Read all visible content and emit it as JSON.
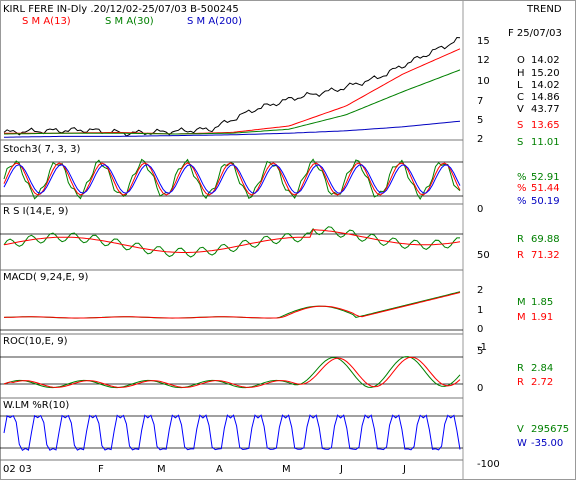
{
  "header": {
    "title": "KIRL FERE IN-Dly .20/12/02-25/07/03  B-500245",
    "trend": "TREND",
    "date": "F 25/07/03",
    "legend": [
      {
        "text": "S M A(13)",
        "color": "#ff0000"
      },
      {
        "text": "S M A(30)",
        "color": "#008000"
      },
      {
        "text": "S M A(200)",
        "color": "#0000c0"
      }
    ]
  },
  "colors": {
    "price": "#000000",
    "sma13": "#ff0000",
    "sma30": "#008000",
    "sma200": "#0000c0",
    "grid": "#000000",
    "blueline": "#0000ff",
    "redline": "#ff0000",
    "greenline": "#008000"
  },
  "x_labels": [
    "02",
    "03",
    "F",
    "M",
    "A",
    "M",
    "J",
    "J"
  ],
  "panels": [
    {
      "id": "price",
      "title": "",
      "ticks": [
        "15",
        "12",
        "10",
        "7",
        "5",
        "2"
      ],
      "readouts": [
        {
          "label": "O",
          "value": "14.02",
          "color": "#000000"
        },
        {
          "label": "H",
          "value": "15.20",
          "color": "#000000"
        },
        {
          "label": "L",
          "value": "14.02",
          "color": "#000000"
        },
        {
          "label": "C",
          "value": "14.86",
          "color": "#000000"
        },
        {
          "label": "V",
          "value": "43.77",
          "color": "#000000"
        },
        {
          "label": "S",
          "value": "13.65",
          "color": "#ff0000"
        },
        {
          "label": "S",
          "value": "11.01",
          "color": "#008000"
        }
      ]
    },
    {
      "id": "stoch",
      "title": "Stoch3( 7, 3, 3)",
      "ticks": [
        "0"
      ],
      "readouts": [
        {
          "label": "%",
          "value": "52.91",
          "color": "#008000"
        },
        {
          "label": "%",
          "value": "51.44",
          "color": "#ff0000"
        },
        {
          "label": "%",
          "value": "50.19",
          "color": "#0000c0"
        }
      ]
    },
    {
      "id": "rsi",
      "title": "R S I(14,E, 9)",
      "ticks": [
        "50"
      ],
      "readouts": [
        {
          "label": "R",
          "value": "69.88",
          "color": "#008000"
        },
        {
          "label": "R",
          "value": "71.32",
          "color": "#ff0000"
        }
      ]
    },
    {
      "id": "macd",
      "title": "MACD( 9,24,E, 9)",
      "ticks": [
        "2",
        "1",
        "0",
        "-1"
      ],
      "readouts": [
        {
          "label": "M",
          "value": "1.85",
          "color": "#008000"
        },
        {
          "label": "M",
          "value": "1.91",
          "color": "#ff0000"
        }
      ]
    },
    {
      "id": "roc",
      "title": "ROC(10,E, 9)",
      "ticks": [
        "5",
        "0"
      ],
      "readouts": [
        {
          "label": "R",
          "value": "2.84",
          "color": "#008000"
        },
        {
          "label": "R",
          "value": "2.72",
          "color": "#ff0000"
        }
      ]
    },
    {
      "id": "wlm",
      "title": "W.LM %R(10)",
      "ticks": [
        "-100"
      ],
      "readouts": [
        {
          "label": "V",
          "value": "295675",
          "color": "#008000"
        },
        {
          "label": "W",
          "value": "-35.00",
          "color": "#0000c0"
        }
      ]
    }
  ],
  "chart_data": {
    "type": "line",
    "title": "KIRL FERE IN-Dly .20/12/02-25/07/03  B-500245",
    "x": [
      "02",
      "03",
      "F",
      "M",
      "A",
      "M",
      "J",
      "J"
    ],
    "series": [
      {
        "name": "S M A(13)",
        "values": [
          3.1,
          3.1,
          3.2,
          3.0,
          3.2,
          4.0,
          6.5,
          10.5,
          13.65
        ]
      },
      {
        "name": "S M A(30)",
        "values": [
          3.0,
          3.1,
          3.1,
          3.0,
          3.1,
          3.6,
          5.4,
          8.3,
          11.01
        ]
      },
      {
        "name": "S M A(200)",
        "values": [
          2.6,
          2.7,
          2.7,
          2.8,
          2.9,
          3.1,
          3.4,
          3.9,
          4.6
        ]
      }
    ],
    "ylim": [
      2,
      17
    ],
    "price_close": [
      3.2,
      3.4,
      3.5,
      3.1,
      3.3,
      3.6,
      6.0,
      7.5,
      8.5,
      10.0,
      12.5,
      14.86
    ],
    "indicators": {
      "stoch": {
        "values": [
          52.91,
          51.44,
          50.19
        ],
        "ylim": [
          0,
          100
        ]
      },
      "rsi": {
        "values": [
          69.88,
          71.32
        ]
      },
      "macd": {
        "values": [
          1.85,
          1.91
        ],
        "ylim": [
          -1,
          2.5
        ]
      },
      "roc": {
        "values": [
          2.84,
          2.72
        ],
        "ylim": [
          -2,
          6
        ]
      },
      "wlm": {
        "values": [
          -35.0
        ],
        "ylim": [
          -100,
          0
        ]
      }
    }
  }
}
